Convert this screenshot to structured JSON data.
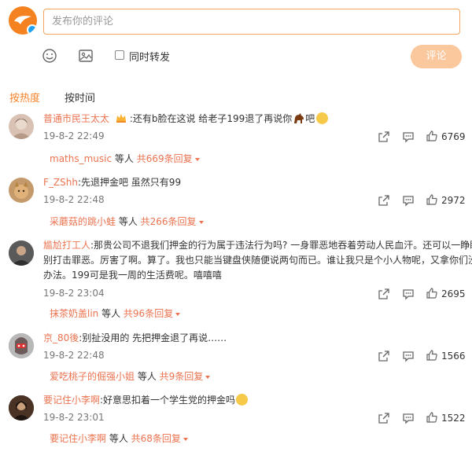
{
  "composer": {
    "placeholder": "发布你的评论",
    "repost_label": "同时转发",
    "submit_label": "评论"
  },
  "sort_tabs": [
    {
      "label": "按热度",
      "active": true
    },
    {
      "label": "按时间",
      "active": false
    }
  ],
  "comments": [
    {
      "user": "普通市民王太太",
      "text": ":还有b脸在这说 给老子199退了再说你",
      "text_end": "吧",
      "date": "19-8-2 22:49",
      "reply_user": "maths_music",
      "reply_mid": " 等人 ",
      "reply_count": "共669条回复",
      "likes": "6769"
    },
    {
      "user": "F_ZShh",
      "text": ":先退押金吧 虽然只有99",
      "date": "19-8-2 22:48",
      "reply_user": "采蘑菇的跳小蛙",
      "reply_mid": " 等人 ",
      "reply_count": "共266条回复",
      "likes": "2972"
    },
    {
      "user": "尴尬打工人",
      "text_lines": [
        ":那贵公司不退我们押金的行为属于违法行为吗? 一身罪恶地吞着劳动人民血汗。还可以一睁眼",
        "别打击罪恶。厉害了啊。算了。我也只能当键盘侠随便说两句而已。谁让我只是个小人物呢，又拿你们没",
        "办法。199可是我一周的生活费呢。嘻嘻嘻"
      ],
      "date": "19-8-2 23:04",
      "reply_user": "抹茶奶盖lin",
      "reply_mid": " 等人 ",
      "reply_count": "共96条回复",
      "likes": "2695"
    },
    {
      "user": "京_80後",
      "text": ":别扯没用的 先把押金退了再说……",
      "date": "19-8-2 22:48",
      "reply_user": "爱吃桃子的倔强小姐",
      "reply_mid": " 等人 ",
      "reply_count": "共9条回复",
      "likes": "1566"
    },
    {
      "user": "要记住小李啊",
      "text": ":好意思扣着一个学生党的押金吗",
      "date": "19-8-2 23:01",
      "reply_user": "要记住小李啊",
      "reply_mid": " 等人 ",
      "reply_count": "共68条回复",
      "likes": "1522"
    }
  ],
  "colors": {
    "accent_orange": "#f7822a",
    "username": "#eb7350",
    "submit_disabled": "#fbc79c",
    "input_border": "#f5a35e"
  },
  "icons": [
    "emoji-icon",
    "image-icon",
    "share-icon",
    "comment-icon",
    "like-icon"
  ]
}
